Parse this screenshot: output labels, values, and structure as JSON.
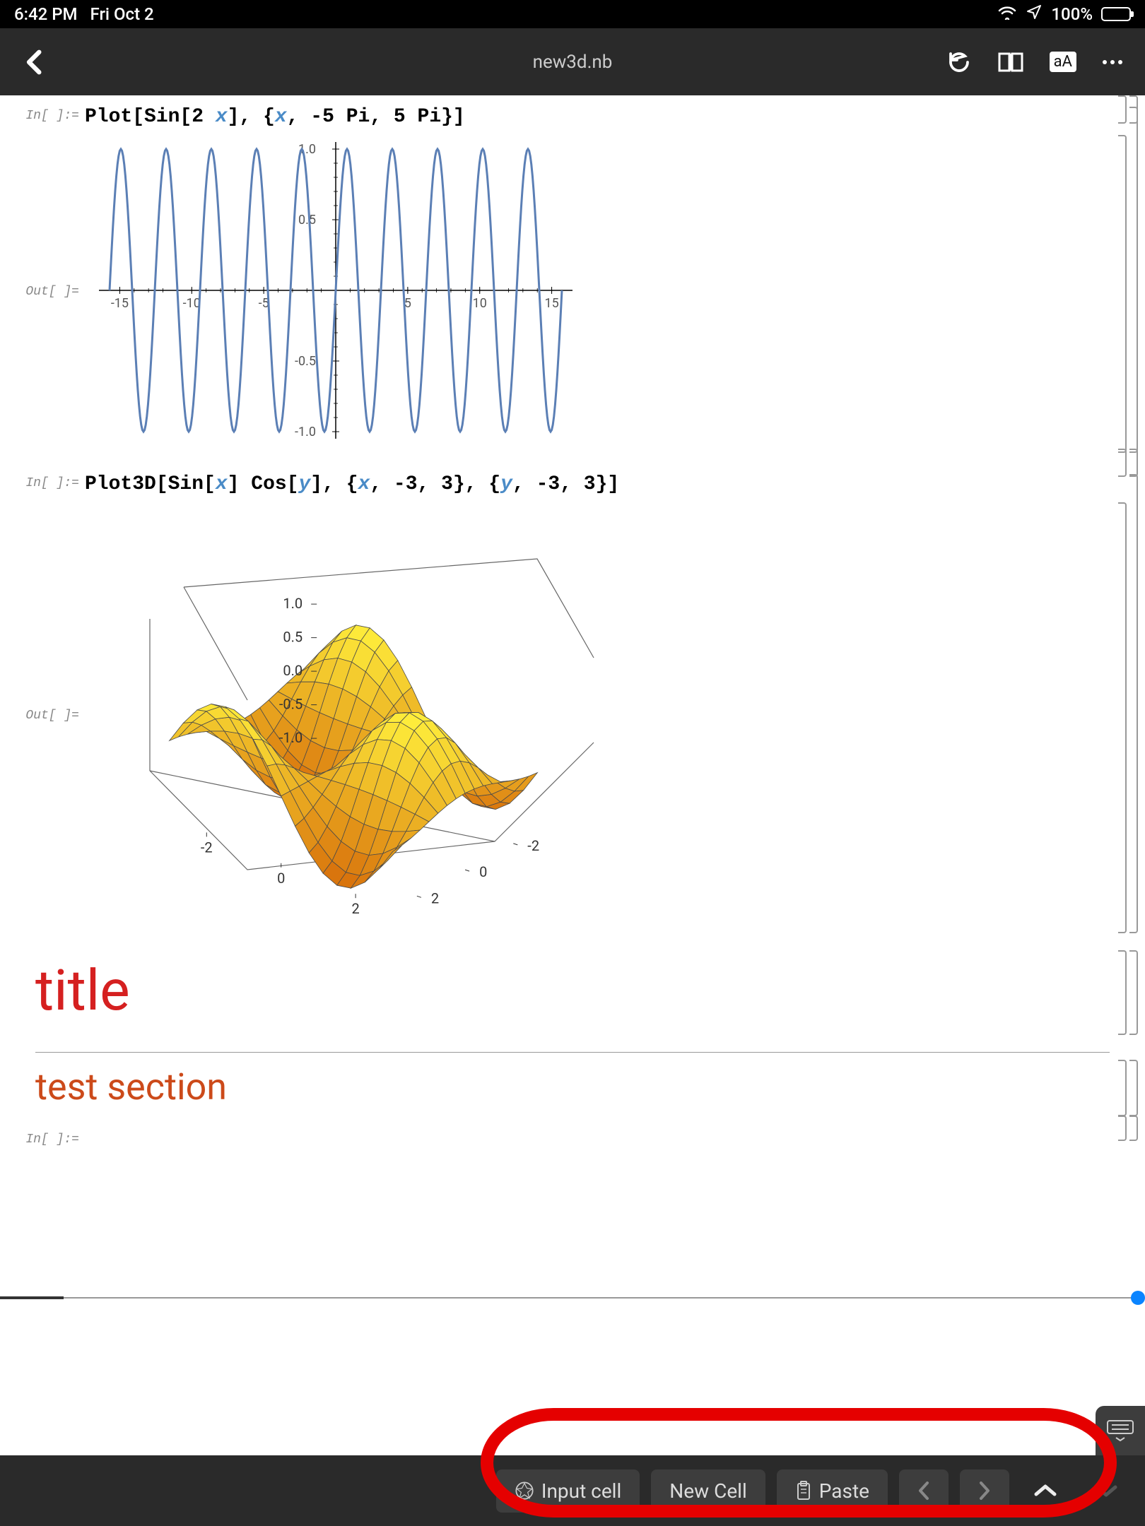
{
  "status": {
    "time": "6:42 PM",
    "date": "Fri Oct 2",
    "battery": "100%"
  },
  "header": {
    "title": "new3d.nb"
  },
  "cells": {
    "in1_label": "In[ ]:=",
    "in1_code_prefix": "Plot[Sin[2 ",
    "in1_var1": "x",
    "in1_code_mid": "], {",
    "in1_var2": "x",
    "in1_code_suffix": ", -5 Pi, 5 Pi}]",
    "out1_label": "Out[ ]=",
    "in2_label": "In[ ]:=",
    "in2_code_prefix": "Plot3D[Sin[",
    "in2_var1": "x",
    "in2_code_mid1": "] Cos[",
    "in2_var2": "y",
    "in2_code_mid2": "], {",
    "in2_var3": "x",
    "in2_code_mid3": ", -3, 3}, {",
    "in2_var4": "y",
    "in2_code_suffix": ", -3, 3}]",
    "out2_label": "Out[ ]=",
    "title_text": "title",
    "section_text": "test section",
    "in3_label": "In[ ]:="
  },
  "chart_data": [
    {
      "type": "line",
      "title": "",
      "function": "Sin[2 x]",
      "xlim": [
        -15.708,
        15.708
      ],
      "ylim": [
        -1.0,
        1.0
      ],
      "x_ticks": [
        -15,
        -10,
        -5,
        5,
        10,
        15
      ],
      "y_ticks": [
        -1.0,
        -0.5,
        0.5,
        1.0
      ],
      "series": [
        {
          "name": "Sin[2x]",
          "color": "#5b7fb5",
          "samples": 400,
          "expression": "sin(2*x)"
        }
      ]
    },
    {
      "type": "surface3d",
      "function": "Sin[x] Cos[y]",
      "xlim": [
        -3,
        3
      ],
      "ylim": [
        -3,
        3
      ],
      "zlim": [
        -1.0,
        1.0
      ],
      "x_ticks": [
        -2,
        0,
        2
      ],
      "y_ticks": [
        -2,
        0,
        2
      ],
      "z_ticks": [
        -1.0,
        -0.5,
        0.0,
        0.5,
        1.0
      ],
      "color_scheme": "orange-yellow"
    }
  ],
  "bottom": {
    "input_cell": "Input cell",
    "new_cell": "New Cell",
    "paste": "Paste"
  }
}
